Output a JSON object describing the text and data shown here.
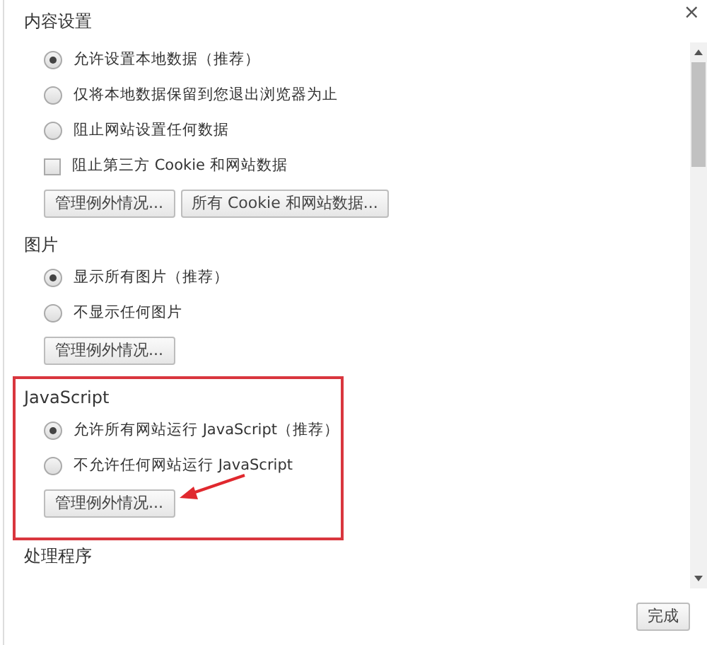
{
  "dialog": {
    "title": "内容设置",
    "close_label": "×"
  },
  "sections": [
    {
      "highlighted": false,
      "options": [
        {
          "kind": "radio",
          "label": "允许设置本地数据（推荐）",
          "selected": true
        },
        {
          "kind": "radio",
          "label": "仅将本地数据保留到您退出浏览器为止",
          "selected": false
        },
        {
          "kind": "radio",
          "label": "阻止网站设置任何数据",
          "selected": false
        },
        {
          "kind": "checkbox",
          "label": "阻止第三方 Cookie 和网站数据",
          "checked": false
        }
      ],
      "buttons": [
        {
          "label": "管理例外情况...",
          "pointed": false
        },
        {
          "label": "所有 Cookie 和网站数据...",
          "pointed": false
        }
      ]
    },
    {
      "heading": "图片",
      "highlighted": false,
      "options": [
        {
          "kind": "radio",
          "label": "显示所有图片（推荐）",
          "selected": true
        },
        {
          "kind": "radio",
          "label": "不显示任何图片",
          "selected": false
        }
      ],
      "buttons": [
        {
          "label": "管理例外情况...",
          "pointed": false
        }
      ]
    },
    {
      "heading": "JavaScript",
      "highlighted": true,
      "options": [
        {
          "kind": "radio",
          "label": "允许所有网站运行 JavaScript（推荐）",
          "selected": true
        },
        {
          "kind": "radio",
          "label": "不允许任何网站运行 JavaScript",
          "selected": false
        }
      ],
      "buttons": [
        {
          "label": "管理例外情况...",
          "pointed": true
        }
      ]
    },
    {
      "heading": "处理程序",
      "highlighted": false
    }
  ],
  "footer": {
    "done_button": "完成"
  }
}
